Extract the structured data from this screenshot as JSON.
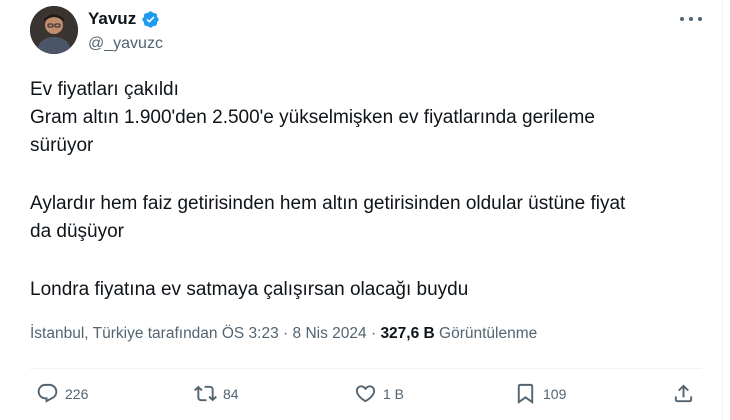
{
  "author": {
    "name": "Yavuz",
    "handle": "@_yavuzc",
    "verified": true,
    "verified_color": "#1d9bf0"
  },
  "tweet": {
    "lines": [
      "Ev fiyatları çakıldı",
      "Gram altın 1.900'den 2.500'e yükselmişken ev fiyatlarında gerileme",
      "sürüyor",
      "Aylardır hem faiz getirisinden hem altın getirisinden oldular üstüne fiyat",
      "da düşüyor",
      "Londra fiyatına ev satmaya çalışırsan olacağı buydu"
    ]
  },
  "meta": {
    "location": "İstanbul, Türkiye tarafından",
    "time": "ÖS 3:23",
    "separator": "·",
    "date": "8 Nis 2024",
    "views_count": "327,6 B",
    "views_label": "Görüntülenme"
  },
  "actions": {
    "replies": "226",
    "reposts": "84",
    "likes": "1 B",
    "bookmarks": "109"
  },
  "icons": [
    "more-icon",
    "verified-icon",
    "reply-icon",
    "repost-icon",
    "like-icon",
    "bookmark-icon",
    "share-icon"
  ]
}
